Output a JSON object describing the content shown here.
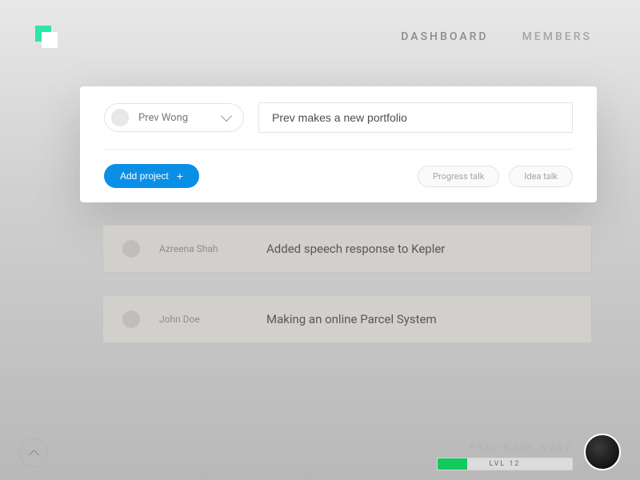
{
  "nav": {
    "dashboard": "DASHBOARD",
    "members": "MEMBERS"
  },
  "compose": {
    "user_name": "Prev Wong",
    "title_value": "Prev makes a new portfolio",
    "add_label": "Add project",
    "progress_label": "Progress talk",
    "idea_label": "Idea talk"
  },
  "feed": [
    {
      "name": "Azreena Shah",
      "text": "Added speech response to Kepler"
    },
    {
      "name": "John Doe",
      "text": "Making an online Parcel System"
    }
  ],
  "footer": {
    "user_name": "PREVINASH WONG",
    "level_label": "LVL 12",
    "level_percent": 22
  }
}
